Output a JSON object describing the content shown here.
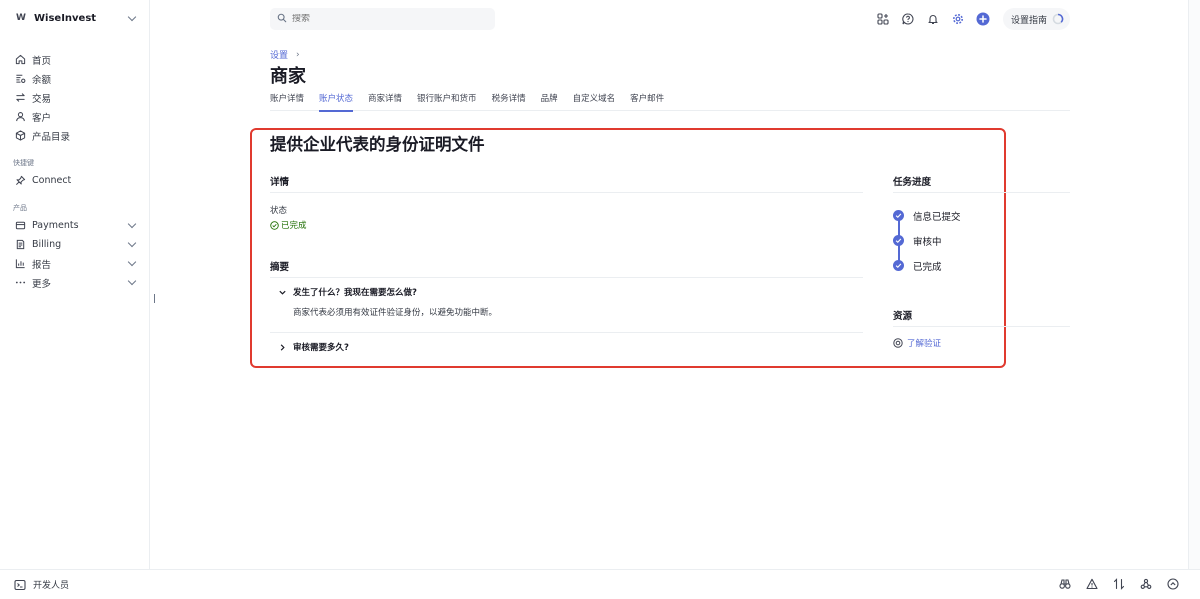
{
  "sidebar": {
    "brand_letter": "W",
    "brand_name": "WiseInvest",
    "main_items": [
      {
        "label": "首页",
        "icon": "home-icon"
      },
      {
        "label": "余额",
        "icon": "balance-icon"
      },
      {
        "label": "交易",
        "icon": "transactions-icon"
      },
      {
        "label": "客户",
        "icon": "customer-icon"
      },
      {
        "label": "产品目录",
        "icon": "product-catalog-icon"
      }
    ],
    "shortcuts_label": "快捷键",
    "shortcut_items": [
      {
        "label": "Connect",
        "icon": "pin-icon"
      }
    ],
    "products_label": "产品",
    "product_items": [
      {
        "label": "Payments",
        "icon": "payments-icon"
      },
      {
        "label": "Billing",
        "icon": "billing-icon"
      },
      {
        "label": "报告",
        "icon": "reports-icon"
      },
      {
        "label": "更多",
        "icon": "more-icon"
      }
    ]
  },
  "topbar": {
    "search_placeholder": "搜索",
    "guide_label": "设置指南"
  },
  "header": {
    "breadcrumb": "设置",
    "title": "商家",
    "tabs": [
      "账户详情",
      "账户状态",
      "商家详情",
      "银行账户和货币",
      "税务详情",
      "品牌",
      "自定义域名",
      "客户邮件"
    ],
    "active_tab": 1
  },
  "content": {
    "doc_title": "提供企业代表的身份证明文件",
    "details_heading": "详情",
    "status_label": "状态",
    "status_value": "已完成",
    "summary_heading": "摘要",
    "faq": [
      {
        "question": "发生了什么？我现在需要怎么做?",
        "answer": "商家代表必须用有效证件验证身份，以避免功能中断。",
        "expanded": true
      },
      {
        "question": "审核需要多久?",
        "expanded": false
      }
    ],
    "progress_heading": "任务进度",
    "steps": [
      "信息已提交",
      "审核中",
      "已完成"
    ],
    "resources_heading": "资源",
    "resource_link": "了解验证"
  },
  "bottombar": {
    "developers_label": "开发人员"
  },
  "colors": {
    "accent": "#5469d4",
    "success": "#217005",
    "highlight_border": "#e03a2f"
  }
}
